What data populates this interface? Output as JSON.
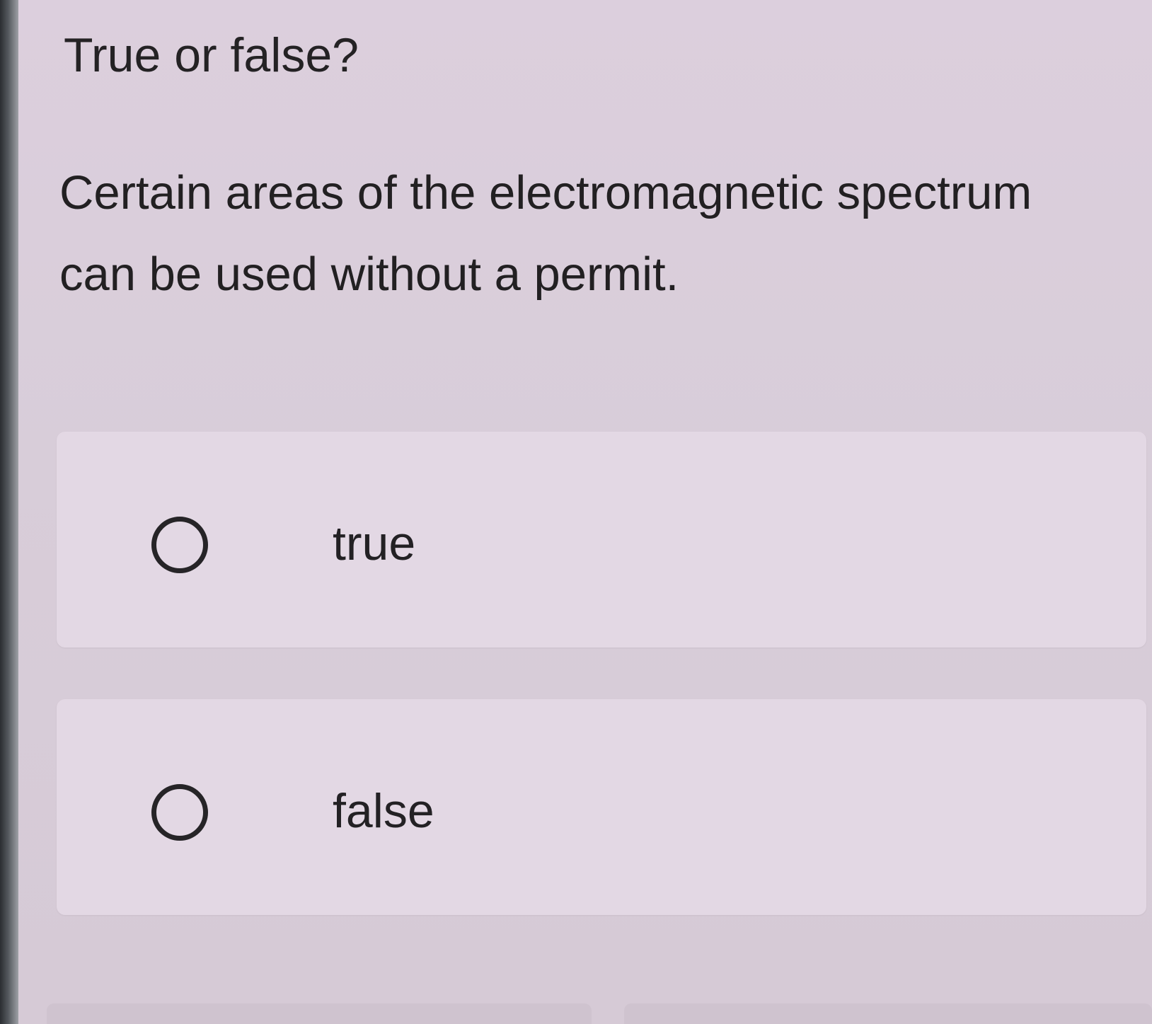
{
  "question": {
    "label": "True or false?",
    "text": "Certain areas of the electromagnetic spectrum can be used without a permit."
  },
  "options": [
    {
      "label": "true",
      "selected": false
    },
    {
      "label": "false",
      "selected": false
    }
  ],
  "icons": {
    "radio": "radio-unselected-circle"
  },
  "colors": {
    "background": "#dccfdc",
    "card": "#e3d8e4",
    "text": "#232124"
  }
}
